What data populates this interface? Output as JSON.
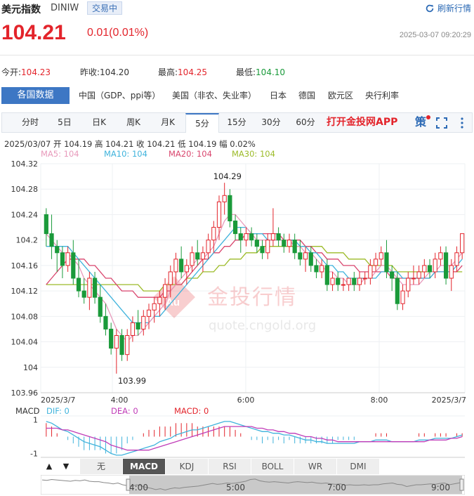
{
  "header": {
    "name": "美元指数",
    "code": "DINIW",
    "status": "交易中",
    "refresh_label": "刷新行情"
  },
  "quote": {
    "price": "104.21",
    "change": "0.01(0.01%)",
    "timestamp": "2025-03-07 09:20:29"
  },
  "stats": {
    "open_label": "今开:",
    "open": "104.23",
    "prev_label": "昨收:",
    "prev": "104.20",
    "high_label": "最高:",
    "high": "104.25",
    "low_label": "最低:",
    "low": "104.10"
  },
  "data_tabs": {
    "active": "各国数据",
    "items": [
      "中国（GDP、ppi等）",
      "美国（非农、失业率）",
      "日本",
      "德国",
      "欧元区",
      "央行利率"
    ]
  },
  "periods": {
    "items": [
      "分时",
      "5日",
      "日K",
      "周K",
      "月K",
      "5分",
      "15分",
      "30分",
      "60分"
    ],
    "active": "5分",
    "app_link": "打开金投网APP",
    "strategy_label": "策"
  },
  "ohlc_text": "2025/03/07  开 104.19  高 104.21  收 104.21  低 104.19  幅 0.02%",
  "ma": {
    "ma5": "MA5: 104",
    "ma10": "MA10: 104",
    "ma20": "MA20: 104",
    "ma30": "MA30: 104"
  },
  "macd_legend": {
    "title": "MACD",
    "dif": "DIF: 0",
    "dea": "DEA: 0",
    "macd": "MACD: 0"
  },
  "indicator_tabs": {
    "up": "▲",
    "down": "▼",
    "items": [
      "无",
      "MACD",
      "KDJ",
      "RSI",
      "BOLL",
      "WR",
      "DMI"
    ],
    "active": "MACD"
  },
  "navigator_labels": [
    "4:00",
    "5:00",
    "7:00",
    "9:00"
  ],
  "watermark": {
    "brand": "金投行情",
    "url": "quote.cngold.org",
    "logo": "Au"
  },
  "colors": {
    "up": "#e3242b",
    "down": "#1a9a3a",
    "ma5": "#e89abb",
    "ma10": "#3fb3dc",
    "ma20": "#d9466e",
    "ma30": "#9cbb28",
    "dif": "#3fb3dc",
    "dea": "#c03cb8",
    "accent": "#3d77c4"
  },
  "chart_data": {
    "type": "candlestick",
    "y_ticks": [
      "104.32",
      "104.28",
      "104.24",
      "104.2",
      "104.16",
      "104.12",
      "104.08",
      "104.04",
      "104",
      "103.96"
    ],
    "ylim": [
      103.96,
      104.32
    ],
    "x_labels": [
      "2025/3/7",
      "4:00",
      "6:00",
      "8:00",
      "2025/3/7"
    ],
    "annotations": {
      "max": "104.29",
      "min": "103.99"
    },
    "candles": [
      [
        104.24,
        104.25,
        104.19,
        104.21
      ],
      [
        104.21,
        104.24,
        104.17,
        104.19
      ],
      [
        104.19,
        104.2,
        104.15,
        104.18
      ],
      [
        104.18,
        104.19,
        104.14,
        104.16
      ],
      [
        104.16,
        104.19,
        104.15,
        104.18
      ],
      [
        104.18,
        104.2,
        104.13,
        104.14
      ],
      [
        104.14,
        104.17,
        104.11,
        104.12
      ],
      [
        104.12,
        104.14,
        104.1,
        104.11
      ],
      [
        104.11,
        104.15,
        104.09,
        104.14
      ],
      [
        104.14,
        104.15,
        104.1,
        104.11
      ],
      [
        104.11,
        104.13,
        104.07,
        104.08
      ],
      [
        104.08,
        104.1,
        104.05,
        104.06
      ],
      [
        104.06,
        104.07,
        104.02,
        104.03
      ],
      [
        104.03,
        104.06,
        103.99,
        104.05
      ],
      [
        104.05,
        104.06,
        104.01,
        104.02
      ],
      [
        104.02,
        104.06,
        104.01,
        104.05
      ],
      [
        104.05,
        104.08,
        104.04,
        104.07
      ],
      [
        104.07,
        104.09,
        104.05,
        104.06
      ],
      [
        104.06,
        104.09,
        104.05,
        104.08
      ],
      [
        104.08,
        104.1,
        104.06,
        104.09
      ],
      [
        104.09,
        104.11,
        104.07,
        104.1
      ],
      [
        104.1,
        104.12,
        104.08,
        104.11
      ],
      [
        104.11,
        104.14,
        104.09,
        104.13
      ],
      [
        104.13,
        104.16,
        104.11,
        104.15
      ],
      [
        104.15,
        104.18,
        104.13,
        104.17
      ],
      [
        104.17,
        104.19,
        104.14,
        104.15
      ],
      [
        104.15,
        104.17,
        104.13,
        104.16
      ],
      [
        104.16,
        104.19,
        104.15,
        104.18
      ],
      [
        104.18,
        104.2,
        104.16,
        104.17
      ],
      [
        104.17,
        104.19,
        104.15,
        104.18
      ],
      [
        104.18,
        104.21,
        104.17,
        104.2
      ],
      [
        104.2,
        104.23,
        104.18,
        104.22
      ],
      [
        104.22,
        104.27,
        104.2,
        104.26
      ],
      [
        104.26,
        104.29,
        104.24,
        104.27
      ],
      [
        104.27,
        104.28,
        104.22,
        104.23
      ],
      [
        104.23,
        104.24,
        104.2,
        104.21
      ],
      [
        104.21,
        104.22,
        104.18,
        104.2
      ],
      [
        104.2,
        104.22,
        104.19,
        104.21
      ],
      [
        104.21,
        104.22,
        104.19,
        104.2
      ],
      [
        104.2,
        104.21,
        104.18,
        104.19
      ],
      [
        104.19,
        104.2,
        104.17,
        104.18
      ],
      [
        104.18,
        104.21,
        104.17,
        104.2
      ],
      [
        104.2,
        104.25,
        104.19,
        104.21
      ],
      [
        104.21,
        104.22,
        104.19,
        104.2
      ],
      [
        104.2,
        104.21,
        104.18,
        104.19
      ],
      [
        104.19,
        104.21,
        104.18,
        104.2
      ],
      [
        104.2,
        104.21,
        104.17,
        104.18
      ],
      [
        104.18,
        104.2,
        104.16,
        104.17
      ],
      [
        104.17,
        104.19,
        104.15,
        104.18
      ],
      [
        104.18,
        104.19,
        104.15,
        104.16
      ],
      [
        104.16,
        104.17,
        104.14,
        104.15
      ],
      [
        104.15,
        104.17,
        104.14,
        104.16
      ],
      [
        104.16,
        104.17,
        104.12,
        104.13
      ],
      [
        104.13,
        104.15,
        104.12,
        104.14
      ],
      [
        104.14,
        104.15,
        104.12,
        104.13
      ],
      [
        104.13,
        104.14,
        104.12,
        104.13
      ],
      [
        104.13,
        104.14,
        104.12,
        104.14
      ],
      [
        104.14,
        104.15,
        104.12,
        104.13
      ],
      [
        104.13,
        104.15,
        104.12,
        104.14
      ],
      [
        104.14,
        104.15,
        104.13,
        104.14
      ],
      [
        104.14,
        104.17,
        104.13,
        104.16
      ],
      [
        104.16,
        104.18,
        104.15,
        104.17
      ],
      [
        104.17,
        104.19,
        104.16,
        104.18
      ],
      [
        104.18,
        104.2,
        104.14,
        104.15
      ],
      [
        104.15,
        104.16,
        104.12,
        104.14
      ],
      [
        104.14,
        104.15,
        104.09,
        104.1
      ],
      [
        104.1,
        104.13,
        104.09,
        104.12
      ],
      [
        104.12,
        104.15,
        104.11,
        104.14
      ],
      [
        104.14,
        104.16,
        104.13,
        104.14
      ],
      [
        104.14,
        104.16,
        104.13,
        104.15
      ],
      [
        104.15,
        104.17,
        104.14,
        104.16
      ],
      [
        104.16,
        104.17,
        104.14,
        104.15
      ],
      [
        104.15,
        104.18,
        104.14,
        104.17
      ],
      [
        104.17,
        104.19,
        104.16,
        104.18
      ],
      [
        104.18,
        104.19,
        104.13,
        104.14
      ],
      [
        104.14,
        104.17,
        104.12,
        104.16
      ],
      [
        104.16,
        104.19,
        104.15,
        104.18
      ],
      [
        104.18,
        104.21,
        104.17,
        104.21
      ]
    ],
    "ma5": [
      104.21,
      104.2,
      104.19,
      104.18,
      104.18,
      104.17,
      104.16,
      104.14,
      104.13,
      104.12,
      104.11,
      104.1,
      104.08,
      104.06,
      104.05,
      104.04,
      104.05,
      104.05,
      104.06,
      104.07,
      104.08,
      104.09,
      104.1,
      104.12,
      104.13,
      104.14,
      104.15,
      104.16,
      104.17,
      104.17,
      104.18,
      104.19,
      104.21,
      104.23,
      104.24,
      104.24,
      104.23,
      104.22,
      104.21,
      104.2,
      104.2,
      104.2,
      104.2,
      104.2,
      104.2,
      104.2,
      104.19,
      104.19,
      104.18,
      104.18,
      104.17,
      104.16,
      104.15,
      104.15,
      104.14,
      104.14,
      104.13,
      104.13,
      104.13,
      104.14,
      104.14,
      104.15,
      104.16,
      104.16,
      104.15,
      104.14,
      104.13,
      104.13,
      104.13,
      104.13,
      104.14,
      104.15,
      104.15,
      104.16,
      104.16,
      104.16,
      104.17,
      104.18
    ],
    "ma10": [
      104.19,
      104.19,
      104.19,
      104.19,
      104.19,
      104.18,
      104.17,
      104.16,
      104.15,
      104.14,
      104.13,
      104.12,
      104.11,
      104.1,
      104.09,
      104.08,
      104.07,
      104.07,
      104.07,
      104.07,
      104.08,
      104.08,
      104.09,
      104.1,
      104.11,
      104.12,
      104.13,
      104.14,
      104.15,
      104.16,
      104.17,
      104.18,
      104.19,
      104.2,
      104.21,
      104.22,
      104.22,
      104.22,
      104.21,
      104.21,
      104.21,
      104.2,
      104.2,
      104.2,
      104.2,
      104.2,
      104.2,
      104.19,
      104.19,
      104.18,
      104.18,
      104.17,
      104.16,
      104.16,
      104.15,
      104.15,
      104.14,
      104.14,
      104.14,
      104.14,
      104.14,
      104.14,
      104.15,
      104.15,
      104.15,
      104.15,
      104.14,
      104.14,
      104.14,
      104.14,
      104.14,
      104.14,
      104.15,
      104.15,
      104.15,
      104.15,
      104.16,
      104.17
    ],
    "ma20": [
      104.13,
      104.14,
      104.15,
      104.16,
      104.17,
      104.17,
      104.17,
      104.17,
      104.16,
      104.16,
      104.15,
      104.14,
      104.14,
      104.13,
      104.12,
      104.12,
      104.12,
      104.11,
      104.11,
      104.11,
      104.11,
      104.11,
      104.12,
      104.12,
      104.13,
      104.13,
      104.14,
      104.15,
      104.16,
      104.17,
      104.17,
      104.18,
      104.18,
      104.19,
      104.19,
      104.2,
      104.2,
      104.21,
      104.21,
      104.21,
      104.21,
      104.21,
      104.21,
      104.21,
      104.2,
      104.2,
      104.2,
      104.2,
      104.19,
      104.19,
      104.18,
      104.18,
      104.17,
      104.17,
      104.17,
      104.16,
      104.16,
      104.16,
      104.15,
      104.15,
      104.15,
      104.15,
      104.15,
      104.15,
      104.14,
      104.14,
      104.14,
      104.14,
      104.14,
      104.14,
      104.14,
      104.14,
      104.15,
      104.15,
      104.15,
      104.15,
      104.15,
      104.16
    ],
    "ma30": [
      104.13,
      104.13,
      104.13,
      104.13,
      104.13,
      104.13,
      104.13,
      104.13,
      104.13,
      104.13,
      104.13,
      104.13,
      104.13,
      104.13,
      104.13,
      104.13,
      104.13,
      104.13,
      104.12,
      104.12,
      104.12,
      104.12,
      104.13,
      104.13,
      104.13,
      104.13,
      104.14,
      104.14,
      104.14,
      104.15,
      104.15,
      104.15,
      104.16,
      104.16,
      104.17,
      104.17,
      104.17,
      104.18,
      104.18,
      104.18,
      104.19,
      104.19,
      104.19,
      104.19,
      104.19,
      104.19,
      104.19,
      104.19,
      104.19,
      104.19,
      104.19,
      104.19,
      104.18,
      104.18,
      104.18,
      104.18,
      104.17,
      104.17,
      104.17,
      104.17,
      104.16,
      104.16,
      104.16,
      104.16,
      104.16,
      104.15,
      104.15,
      104.15,
      104.15,
      104.15,
      104.15,
      104.15,
      104.15,
      104.15,
      104.15,
      104.15,
      104.15,
      104.15
    ],
    "macd_ticks": [
      "1",
      "-1"
    ],
    "dif": [
      0.9,
      0.8,
      0.6,
      0.4,
      0.3,
      0.1,
      -0.1,
      -0.3,
      -0.4,
      -0.5,
      -0.6,
      -0.8,
      -1.0,
      -1.1,
      -1.1,
      -1.0,
      -0.9,
      -0.8,
      -0.7,
      -0.6,
      -0.5,
      -0.3,
      -0.2,
      -0.1,
      0.1,
      0.2,
      0.3,
      0.4,
      0.4,
      0.5,
      0.6,
      0.7,
      0.8,
      0.9,
      0.9,
      0.8,
      0.7,
      0.6,
      0.5,
      0.4,
      0.3,
      0.3,
      0.2,
      0.2,
      0.1,
      0.1,
      0.0,
      -0.1,
      -0.2,
      -0.2,
      -0.3,
      -0.3,
      -0.4,
      -0.4,
      -0.4,
      -0.4,
      -0.4,
      -0.4,
      -0.3,
      -0.3,
      -0.3,
      -0.2,
      -0.2,
      -0.2,
      -0.3,
      -0.3,
      -0.3,
      -0.3,
      -0.3,
      -0.2,
      -0.2,
      -0.2,
      -0.1,
      -0.1,
      -0.1,
      -0.1,
      0.0,
      0.1
    ],
    "dea": [
      0.5,
      0.5,
      0.5,
      0.4,
      0.4,
      0.3,
      0.2,
      0.1,
      0.0,
      -0.1,
      -0.2,
      -0.3,
      -0.5,
      -0.6,
      -0.7,
      -0.8,
      -0.8,
      -0.8,
      -0.8,
      -0.8,
      -0.7,
      -0.6,
      -0.5,
      -0.4,
      -0.3,
      -0.2,
      -0.1,
      0.0,
      0.1,
      0.2,
      0.3,
      0.4,
      0.5,
      0.6,
      0.6,
      0.6,
      0.6,
      0.6,
      0.6,
      0.5,
      0.5,
      0.4,
      0.4,
      0.3,
      0.3,
      0.2,
      0.2,
      0.1,
      0.0,
      0.0,
      -0.1,
      -0.1,
      -0.2,
      -0.2,
      -0.3,
      -0.3,
      -0.3,
      -0.3,
      -0.3,
      -0.3,
      -0.3,
      -0.3,
      -0.3,
      -0.3,
      -0.3,
      -0.3,
      -0.3,
      -0.3,
      -0.3,
      -0.3,
      -0.3,
      -0.2,
      -0.2,
      -0.2,
      -0.2,
      -0.1,
      -0.1,
      0.0
    ]
  }
}
